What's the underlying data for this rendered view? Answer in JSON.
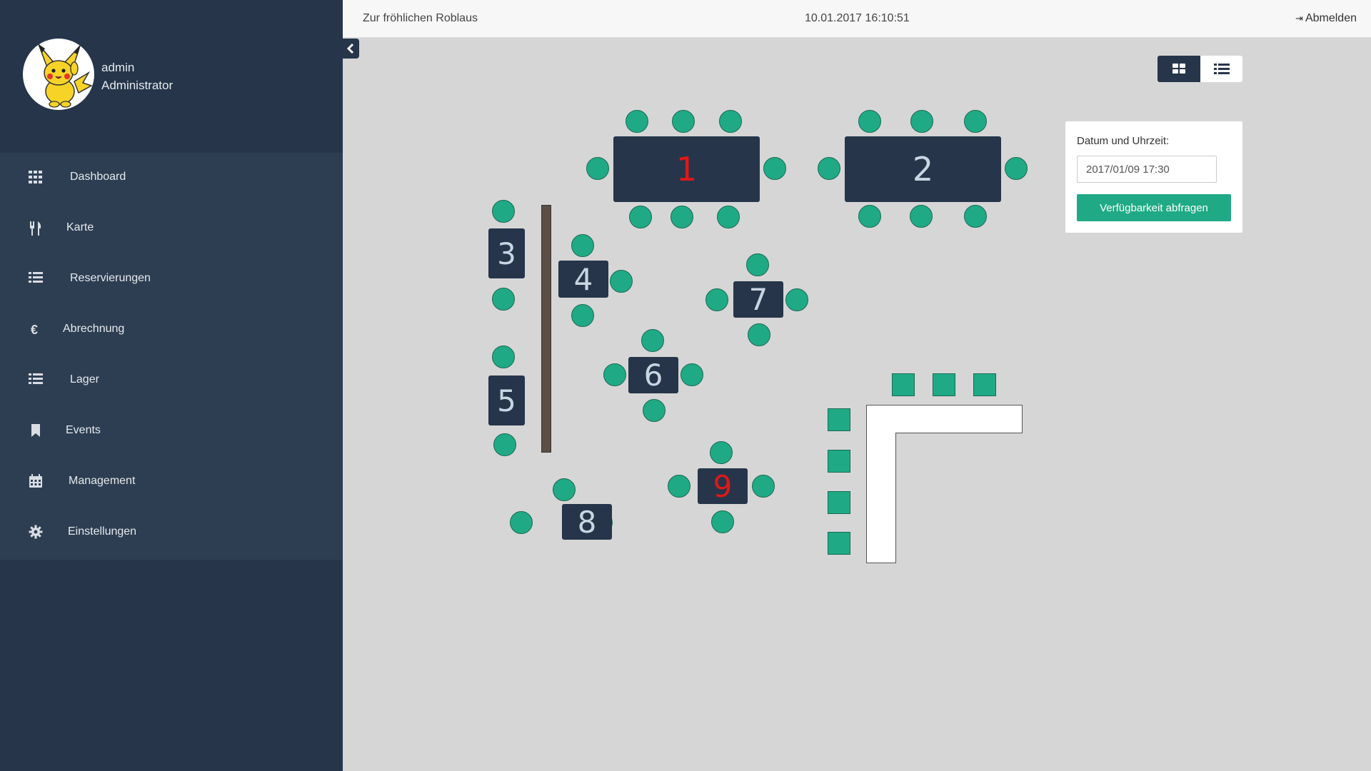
{
  "app": {
    "restaurant_name": "Zur fröhlichen Roblaus",
    "datetime": "10.01.2017 16:10:51",
    "logout_label": "Abmelden"
  },
  "user": {
    "name": "admin",
    "role": "Administrator"
  },
  "nav": [
    {
      "label": "Dashboard",
      "icon": "grid-icon"
    },
    {
      "label": "Karte",
      "icon": "cutlery-icon"
    },
    {
      "label": "Reservierungen",
      "icon": "list-icon"
    },
    {
      "label": "Abrechnung",
      "icon": "euro-icon"
    },
    {
      "label": "Lager",
      "icon": "list-icon"
    },
    {
      "label": "Events",
      "icon": "bookmark-icon"
    },
    {
      "label": "Management",
      "icon": "calendar-icon"
    },
    {
      "label": "Einstellungen",
      "icon": "gear-icon"
    }
  ],
  "view_toggle": {
    "active": "grid",
    "options": [
      "grid",
      "list"
    ]
  },
  "availability": {
    "label": "Datum und Uhrzeit:",
    "value": "2017/01/09 17:30",
    "button_label": "Verfügbarkeit abfragen"
  },
  "tables": [
    {
      "number": "1",
      "reserved": true
    },
    {
      "number": "2",
      "reserved": false
    },
    {
      "number": "3",
      "reserved": false
    },
    {
      "number": "4",
      "reserved": false
    },
    {
      "number": "5",
      "reserved": false
    },
    {
      "number": "6",
      "reserved": false
    },
    {
      "number": "7",
      "reserved": false
    },
    {
      "number": "8",
      "reserved": false
    },
    {
      "number": "9",
      "reserved": true
    }
  ],
  "colors": {
    "sidebar": "#26354a",
    "nav_background": "#2e3e52",
    "accent": "#1faa85",
    "reserved": "#e01818",
    "floor": "#d6d6d6"
  }
}
